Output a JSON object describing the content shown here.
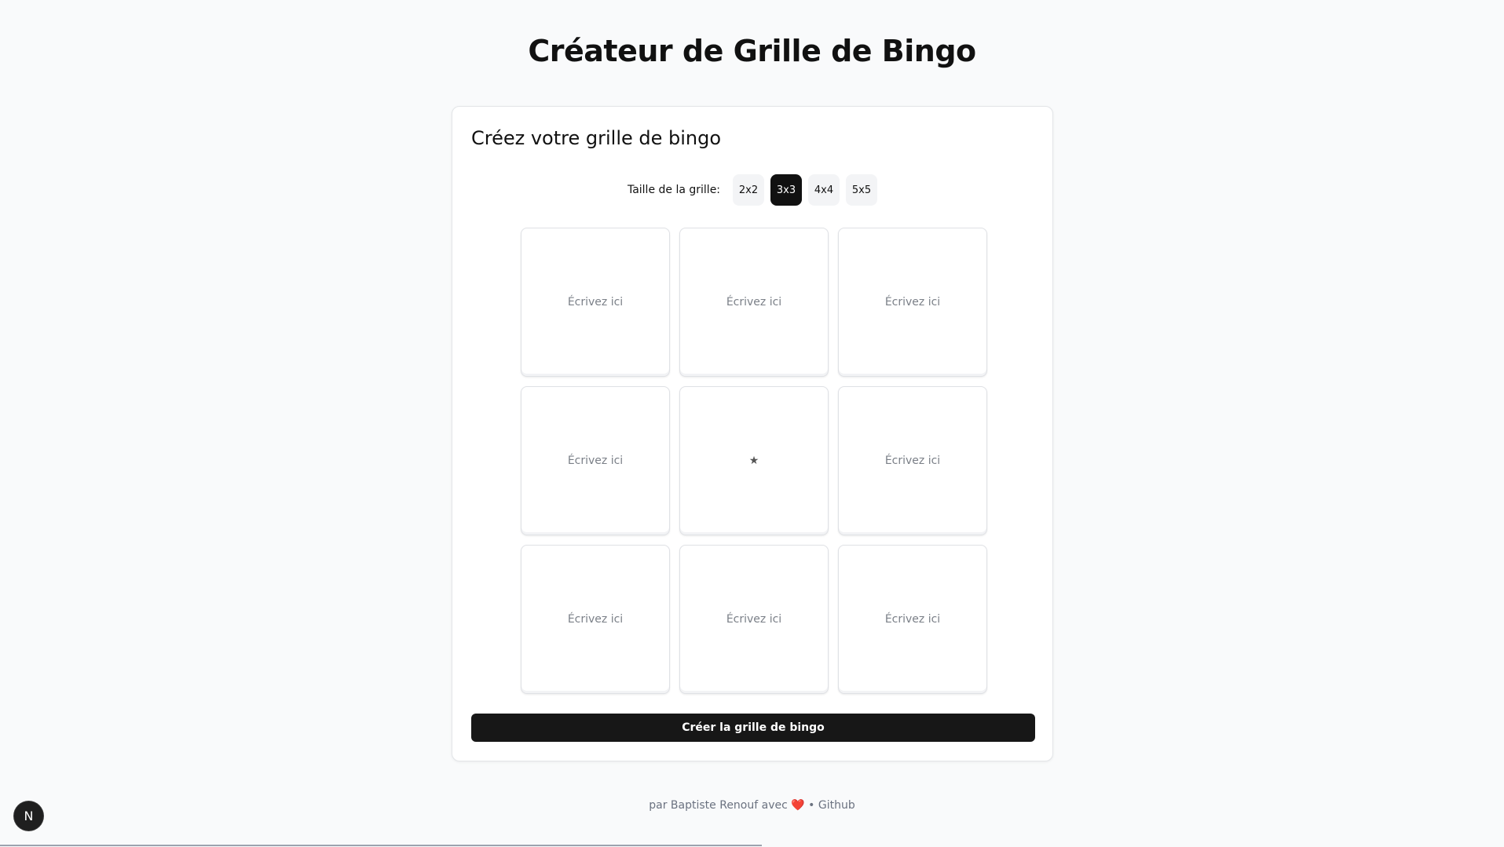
{
  "header": {
    "title": "Créateur de Grille de Bingo"
  },
  "card": {
    "title": "Créez votre grille de bingo",
    "size_label": "Taille de la grille:",
    "sizes": [
      "2x2",
      "3x3",
      "4x4",
      "5x5"
    ],
    "selected_size": "3x3",
    "cells": [
      "Écrivez ici",
      "Écrivez ici",
      "Écrivez ici",
      "Écrivez ici",
      "★",
      "Écrivez ici",
      "Écrivez ici",
      "Écrivez ici",
      "Écrivez ici"
    ],
    "create_label": "Créer la grille de bingo"
  },
  "footer": {
    "prefix": "par Baptiste Renouf avec",
    "heart": "❤️",
    "separator": "•",
    "link": "Github"
  },
  "badge": {
    "letter": "N"
  },
  "colors": {
    "accent": "#111111",
    "background": "#f9fafb",
    "heart": "#e11d2e"
  }
}
